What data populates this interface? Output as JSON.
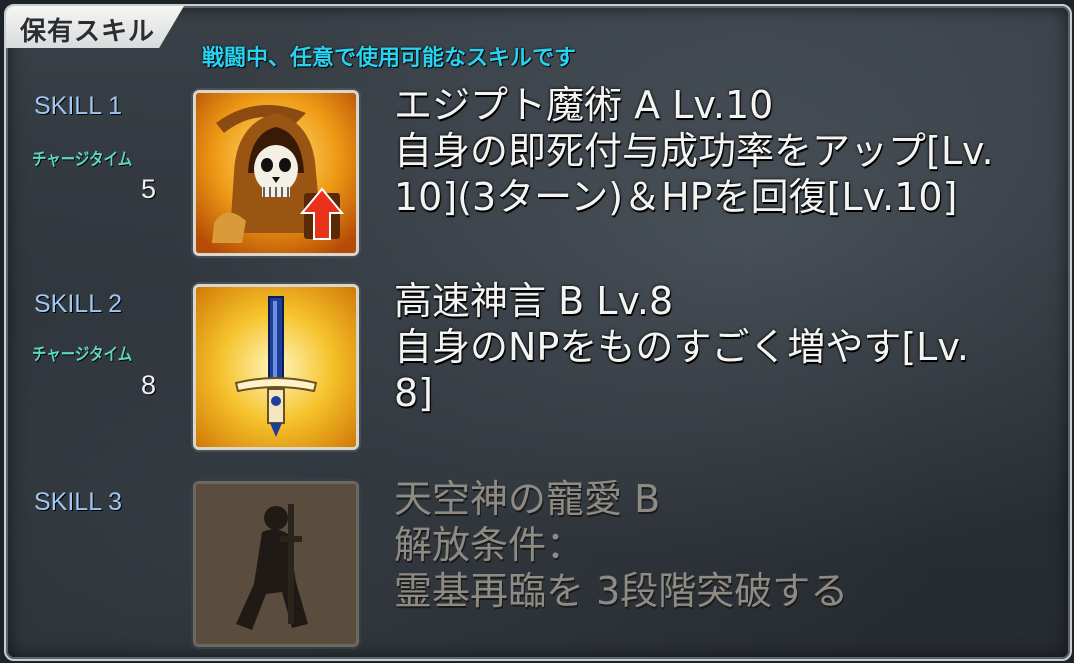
{
  "panel": {
    "tab_title": "保有スキル",
    "subtitle": "戦闘中、任意で使用可能なスキルです"
  },
  "skills": [
    {
      "label": "SKILL 1",
      "charge_label": "チャージタイム",
      "charge_value": "5",
      "name_line": "エジプト魔術 A Lv.10",
      "desc_line1": "自身の即死付与成功率をアップ[Lv.",
      "desc_line2": "10](3ターン)＆HPを回復[Lv.10]",
      "icon": "reaper-skull-up-arrow-icon"
    },
    {
      "label": "SKILL 2",
      "charge_label": "チャージタイム",
      "charge_value": "8",
      "name_line": "高速神言 B Lv.8",
      "desc_line1": "自身のNPをものすごく増やす[Lv.",
      "desc_line2": "8]",
      "icon": "sword-icon"
    },
    {
      "label": "SKILL 3",
      "name_line": "天空神の寵愛 B",
      "desc_line1": "解放条件：",
      "desc_line2": "霊基再臨を 3段階突破する",
      "icon": "kneeling-knight-icon",
      "locked": true
    }
  ],
  "colors": {
    "subtitle": "#27d3f0",
    "skill_label": "#9ec6f0",
    "charge_label": "#5fd7c0",
    "text": "#f4f4f2",
    "locked_text": "#8e8a84"
  }
}
